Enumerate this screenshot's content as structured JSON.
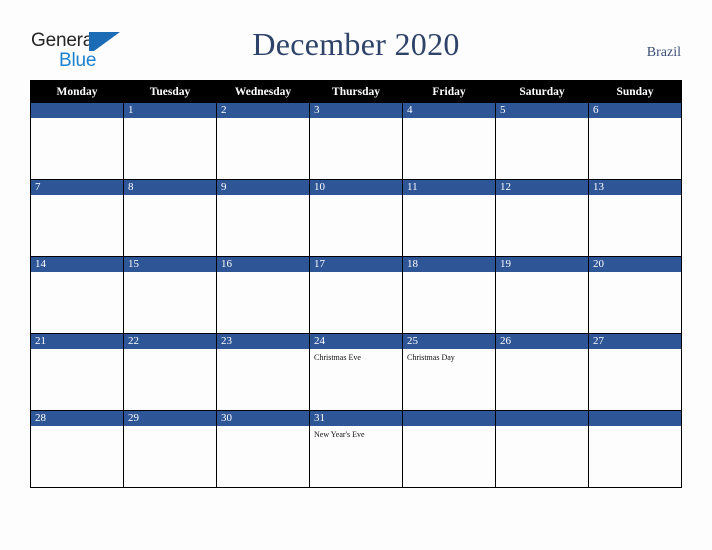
{
  "brand": {
    "name_top": "General",
    "name_bottom": "Blue",
    "color_dark": "#262626",
    "color_blue": "#1b82d2",
    "mark_color": "#1b6cb5"
  },
  "header": {
    "title": "December 2020",
    "region": "Brazil",
    "title_color": "#2e4369",
    "region_color": "#3c4f73"
  },
  "calendar": {
    "header_bg": "#000000",
    "header_fg": "#ffffff",
    "daynum_bg": "#2e5596",
    "daynum_fg": "#ffffff",
    "cell_bg": "#fdfdfd",
    "border_color": "#000000",
    "weekdays": [
      "Monday",
      "Tuesday",
      "Wednesday",
      "Thursday",
      "Friday",
      "Saturday",
      "Sunday"
    ],
    "weeks": [
      [
        {
          "day": "",
          "events": []
        },
        {
          "day": "1",
          "events": []
        },
        {
          "day": "2",
          "events": []
        },
        {
          "day": "3",
          "events": []
        },
        {
          "day": "4",
          "events": []
        },
        {
          "day": "5",
          "events": []
        },
        {
          "day": "6",
          "events": []
        }
      ],
      [
        {
          "day": "7",
          "events": []
        },
        {
          "day": "8",
          "events": []
        },
        {
          "day": "9",
          "events": []
        },
        {
          "day": "10",
          "events": []
        },
        {
          "day": "11",
          "events": []
        },
        {
          "day": "12",
          "events": []
        },
        {
          "day": "13",
          "events": []
        }
      ],
      [
        {
          "day": "14",
          "events": []
        },
        {
          "day": "15",
          "events": []
        },
        {
          "day": "16",
          "events": []
        },
        {
          "day": "17",
          "events": []
        },
        {
          "day": "18",
          "events": []
        },
        {
          "day": "19",
          "events": []
        },
        {
          "day": "20",
          "events": []
        }
      ],
      [
        {
          "day": "21",
          "events": []
        },
        {
          "day": "22",
          "events": []
        },
        {
          "day": "23",
          "events": []
        },
        {
          "day": "24",
          "events": [
            "Christmas Eve"
          ]
        },
        {
          "day": "25",
          "events": [
            "Christmas Day"
          ]
        },
        {
          "day": "26",
          "events": []
        },
        {
          "day": "27",
          "events": []
        }
      ],
      [
        {
          "day": "28",
          "events": []
        },
        {
          "day": "29",
          "events": []
        },
        {
          "day": "30",
          "events": []
        },
        {
          "day": "31",
          "events": [
            "New Year's Eve"
          ]
        },
        {
          "day": "",
          "events": []
        },
        {
          "day": "",
          "events": []
        },
        {
          "day": "",
          "events": []
        }
      ]
    ]
  }
}
